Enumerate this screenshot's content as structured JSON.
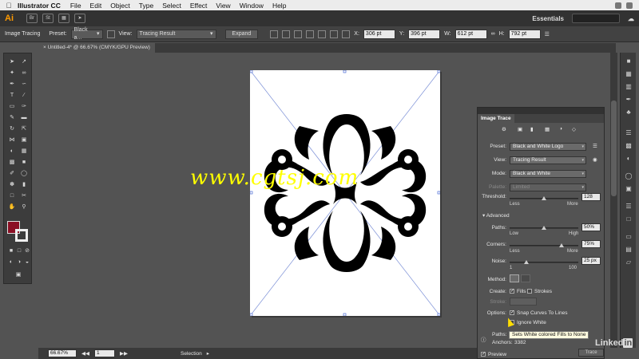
{
  "menubar": {
    "app_name": "Illustrator CC",
    "items": [
      "File",
      "Edit",
      "Object",
      "Type",
      "Select",
      "Effect",
      "View",
      "Window",
      "Help"
    ]
  },
  "appbar": {
    "logo": "Ai",
    "workspace": "Essentials"
  },
  "control_bar": {
    "mode_label": "Image Tracing",
    "preset_label": "Preset:",
    "preset_value": "Black a...",
    "view_label": "View:",
    "view_value": "Tracing Result",
    "expand_label": "Expand",
    "x_label": "X:",
    "x_value": "306 pt",
    "y_label": "Y:",
    "y_value": "396 pt",
    "w_label": "W:",
    "w_value": "612 pt",
    "h_label": "H:",
    "h_value": "792 pt"
  },
  "document": {
    "tab_title": "Untitled-4* @ 66.67% (CMYK/GPU Preview)"
  },
  "watermark": "www.cgtsj.com",
  "image_trace": {
    "title": "Image Trace",
    "preset_label": "Preset:",
    "preset_value": "Black and White Logo",
    "view_label": "View:",
    "view_value": "Tracing Result",
    "mode_label": "Mode:",
    "mode_value": "Black and White",
    "palette_label": "Palette:",
    "palette_value": "Limited",
    "threshold_label": "Threshold:",
    "threshold_value": "128",
    "threshold_fraction": 0.5,
    "threshold_less": "Less",
    "threshold_more": "More",
    "advanced_label": "Advanced",
    "paths_label": "Paths:",
    "paths_value": "50%",
    "paths_fraction": 0.5,
    "paths_low": "Low",
    "paths_high": "High",
    "corners_label": "Corners:",
    "corners_value": "75%",
    "corners_fraction": 0.75,
    "corners_less": "Less",
    "corners_more": "More",
    "noise_label": "Noise:",
    "noise_value": "25 px",
    "noise_min": "1",
    "noise_max": "100",
    "noise_fraction": 0.24,
    "method_label": "Method:",
    "create_label": "Create:",
    "fills_label": "Fills",
    "strokes_label": "Strokes",
    "stroke_label": "Stroke:",
    "options_label": "Options:",
    "snap_label": "Snap Curves To Lines",
    "ignore_white_label": "Ignore White",
    "paths_info_label": "Paths:",
    "anchors_info_label": "Anchors:",
    "anchors_info_value": "3382",
    "preview_label": "Preview",
    "trace_button": "Trace"
  },
  "tooltip": "Sets White colored Fills to None",
  "linkedin": {
    "brand": "Linked",
    "in": "in"
  },
  "status_bar": {
    "zoom_value": "66.67%",
    "page_value": "1",
    "selection_label": "Selection"
  },
  "colors": {
    "fill_swatch": "#8b0f24",
    "accent": "#ff9a00"
  }
}
